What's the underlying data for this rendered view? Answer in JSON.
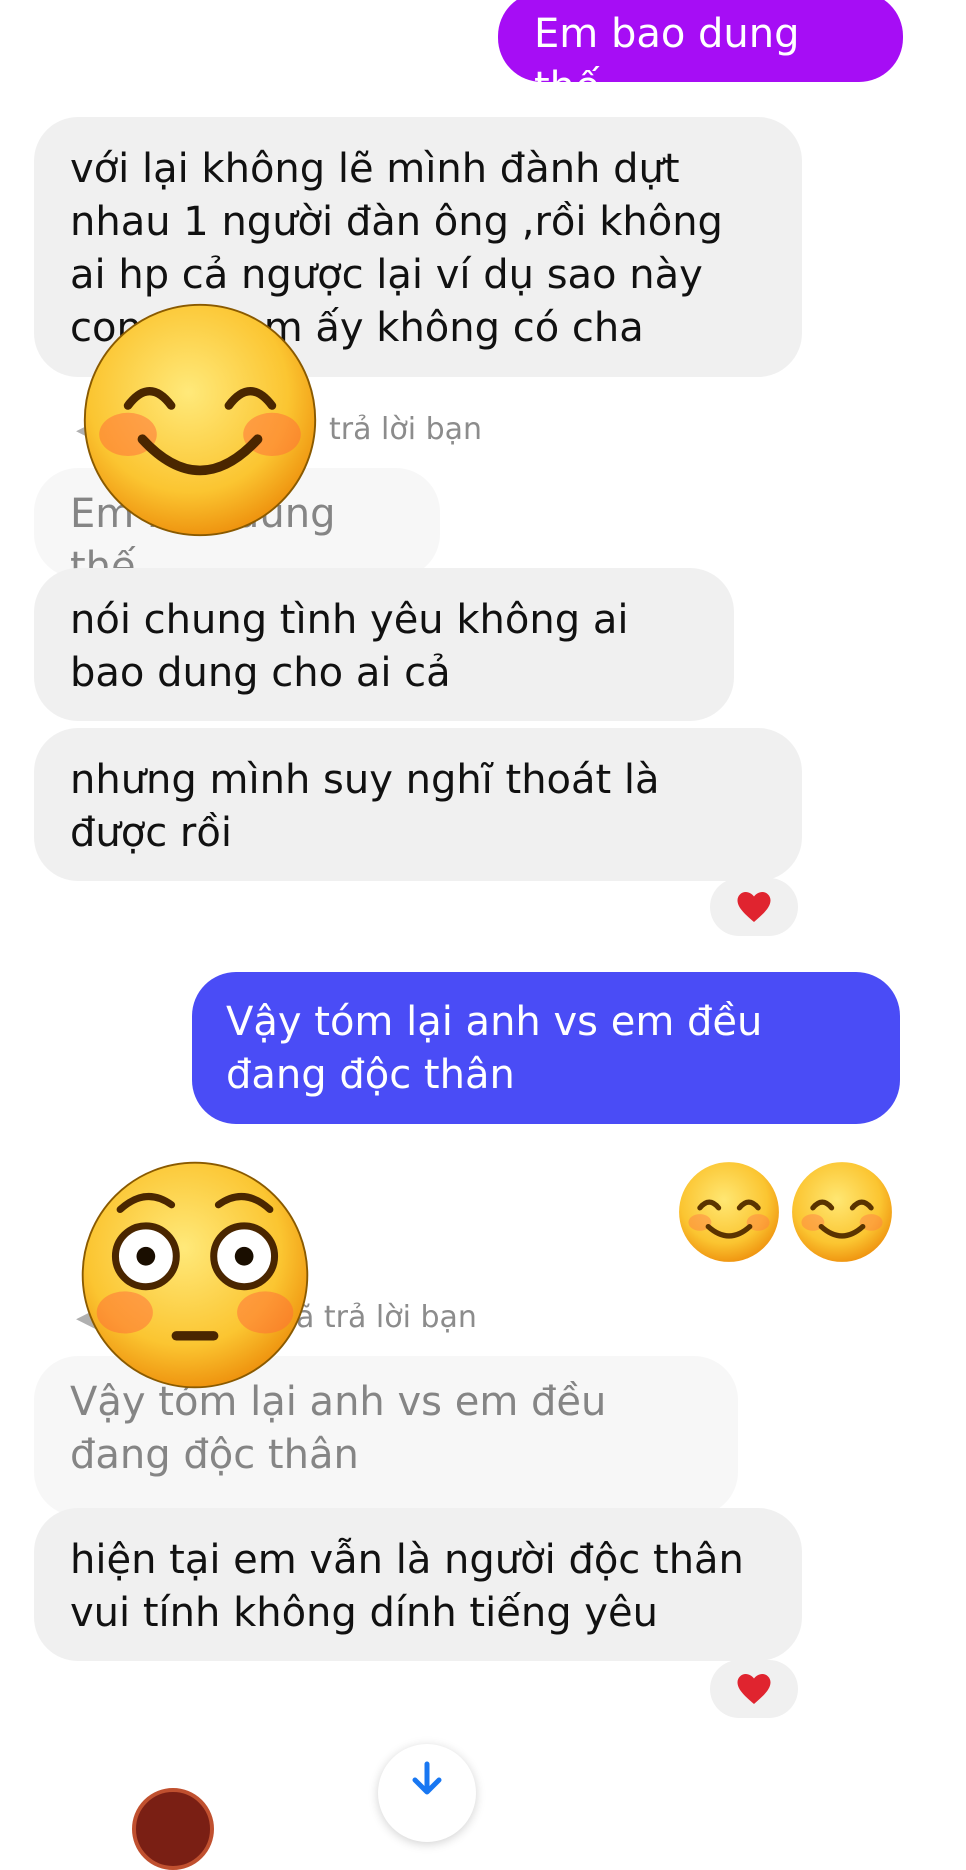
{
  "messages": [
    {
      "id": "m1",
      "text": "Em bao dung thế"
    },
    {
      "id": "m2",
      "text": "với lại không lẽ mình đành dựt nhau 1 người đàn ông ,rồi không ai hp cả ngược lại ví dụ sao này con của em ấy không có cha"
    },
    {
      "id": "r1",
      "label": "trả lời bạn"
    },
    {
      "id": "q1",
      "text": "Em bao dung thế"
    },
    {
      "id": "m3",
      "text": "nói chung tình yêu không ai bao dung cho ai cả"
    },
    {
      "id": "m4",
      "text": "nhưng mình suy nghĩ thoát là được rồi"
    },
    {
      "id": "m5",
      "text": "Vậy tóm lại anh vs em đều đang độc thân"
    },
    {
      "id": "r2",
      "label": "ã trả lời bạn"
    },
    {
      "id": "q2",
      "text": "Vậy tóm lại anh vs em đều đang độc thân"
    },
    {
      "id": "m6",
      "text": "hiện tại em vẫn là người độc thân vui tính không dính tiếng yêu"
    }
  ],
  "colors": {
    "sent_purple": "#a60df5",
    "sent_blue": "#4a4cf6",
    "heart": "#e0242f",
    "received_bg": "#f0f0f0"
  },
  "icons": {
    "reaction": "heart-icon",
    "scroll": "arrow-down-icon",
    "overlay_1": "smiling-face-emoji",
    "overlay_2": "flushed-face-emoji",
    "sent_emoji": "smiling-face-emoji"
  }
}
